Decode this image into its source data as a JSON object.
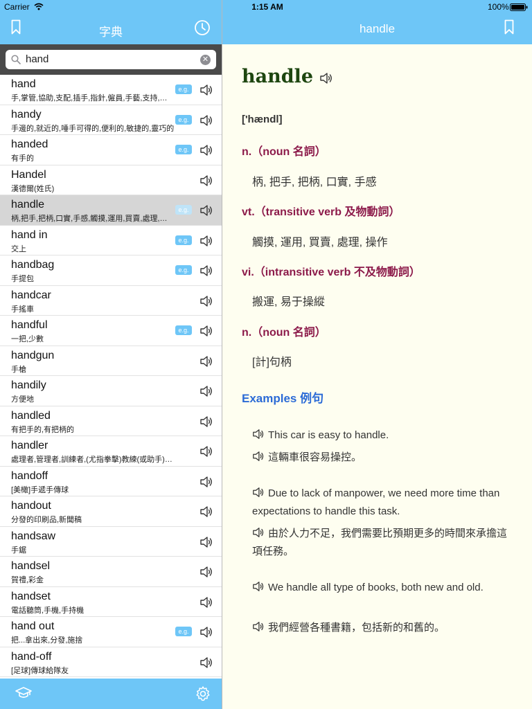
{
  "status": {
    "carrier": "Carrier",
    "time": "1:15 AM",
    "battery": "100%"
  },
  "left_header": {
    "title": "字典"
  },
  "search": {
    "value": "hand"
  },
  "words": [
    {
      "word": "hand",
      "def": "手,掌管,協助,支配,插手,指針,僱員,手藝,支持,手工",
      "eg": "e.g."
    },
    {
      "word": "handy",
      "def": "手邊的,就近的,唾手可得的,便利的,敏捷的,靈巧的",
      "eg": "e.g."
    },
    {
      "word": "handed",
      "def": "有手的",
      "eg": "e.g."
    },
    {
      "word": "Handel",
      "def": "漢德爾(姓氏)",
      "eg": ""
    },
    {
      "word": "handle",
      "def": "柄,把手,把柄,口實,手感,觸摸,運用,買賣,處理,操作",
      "eg": "e.g.",
      "selected": true
    },
    {
      "word": "hand in",
      "def": "交上",
      "eg": "e.g."
    },
    {
      "word": "handbag",
      "def": "手提包",
      "eg": "e.g."
    },
    {
      "word": "handcar",
      "def": "手搖車",
      "eg": ""
    },
    {
      "word": "handful",
      "def": "一把,少數",
      "eg": "e.g."
    },
    {
      "word": "handgun",
      "def": "手槍",
      "eg": ""
    },
    {
      "word": "handily",
      "def": "方便地",
      "eg": ""
    },
    {
      "word": "handled",
      "def": "有把手的,有把柄的",
      "eg": ""
    },
    {
      "word": "handler",
      "def": "處理者,管理者,訓練者,(尤指拳擊)教練(或助手)的人",
      "eg": ""
    },
    {
      "word": "handoff",
      "def": "[美橄]手遞手傳球",
      "eg": ""
    },
    {
      "word": "handout",
      "def": "分發的印刷品,新聞稿",
      "eg": ""
    },
    {
      "word": "handsaw",
      "def": "手鋸",
      "eg": ""
    },
    {
      "word": "handsel",
      "def": "賀禮,彩金",
      "eg": ""
    },
    {
      "word": "handset",
      "def": "電話聽筒,手機,手持機",
      "eg": ""
    },
    {
      "word": "hand out",
      "def": "把...拿出來,分發,施捨",
      "eg": "e.g."
    },
    {
      "word": "hand-off",
      "def": "[足球]傳球給隊友",
      "eg": ""
    }
  ],
  "entry": {
    "title": "handle",
    "word": "handle",
    "phonetic": "['hændl]",
    "senses": [
      {
        "pos": "n.（noun 名詞）",
        "meaning": "柄, 把手, 把柄, 口實, 手感"
      },
      {
        "pos": "vt.（transitive verb 及物動詞）",
        "meaning": "觸摸, 運用, 買賣, 處理, 操作"
      },
      {
        "pos": "vi.（intransitive verb 不及物動詞）",
        "meaning": "搬運, 易于操縱"
      },
      {
        "pos": "n.（noun 名詞）",
        "meaning": "[計]句柄"
      }
    ],
    "examples_heading": "Examples 例句",
    "examples": [
      {
        "en": "This car is easy to handle.",
        "zh": "這輛車很容易操控。"
      },
      {
        "en": "Due to lack of manpower, we need more time than expectations to handle this task.",
        "zh": "由於人力不足，我們需要比預期更多的時間來承擔這項任務。"
      },
      {
        "en": "We handle all type of books, both new and old.",
        "zh": "我們經營各種書籍，包括新的和舊的。"
      }
    ]
  },
  "colors": {
    "accent": "#6ec6f7",
    "word_green": "#1e4610",
    "pos_red": "#8c1a4a",
    "example_blue": "#2c6bd6",
    "detail_bg": "#fefef0"
  }
}
